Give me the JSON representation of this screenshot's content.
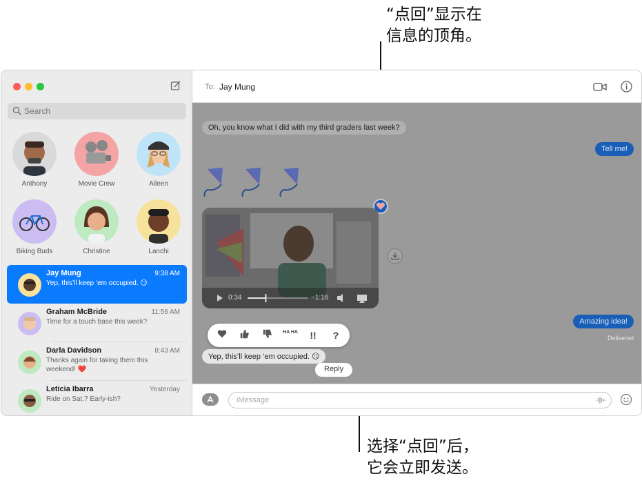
{
  "annotations": {
    "top_line1": "“点回”显示在",
    "top_line2": "信息的顶角。",
    "bottom_line1": "选择“点回”后，",
    "bottom_line2": "它会立即发送。"
  },
  "sidebar": {
    "search_placeholder": "Search",
    "pinned": [
      {
        "name": "Anthony",
        "icon": "memoji-avatar",
        "bg": "#d9d9d9"
      },
      {
        "name": "Movie Crew",
        "icon": "movie-projector-avatar",
        "bg": "#f4a4a4"
      },
      {
        "name": "Aileen",
        "icon": "memoji-avatar",
        "bg": "#bfe3f7"
      },
      {
        "name": "Biking Buds",
        "icon": "bicycle-avatar",
        "bg": "#cbbdf2"
      },
      {
        "name": "Christine",
        "icon": "memoji-avatar",
        "bg": "#bdeac0"
      },
      {
        "name": "Lanchi",
        "icon": "memoji-avatar",
        "bg": "#f7e29c"
      }
    ],
    "conversations": [
      {
        "name": "Jay Mung",
        "time": "9:38 AM",
        "preview": "Yep, this’ll keep ‘em occupied. 😏",
        "selected": true
      },
      {
        "name": "Graham McBride",
        "time": "11:56 AM",
        "preview": "Time for a touch base this week?"
      },
      {
        "name": "Darla Davidson",
        "time": "8:43 AM",
        "preview": "Thanks again for taking them this weekend! ❤️"
      },
      {
        "name": "Leticia Ibarra",
        "time": "Yesterday",
        "preview": "Ride on Sat.? Early-ish?"
      }
    ]
  },
  "header": {
    "to_label": "To:",
    "recipient": "Jay Mung"
  },
  "messages": {
    "incoming_1": "Oh, you know what I did with my third graders last week?",
    "outgoing_1": "Tell me!",
    "outgoing_2": "Amazing idea!",
    "delivered": "Delivered",
    "selected": "Yep, this’ll keep ‘em occupied. 😏",
    "video_elapsed": "0:34",
    "video_remaining": "−1:16",
    "video_progress": 0.3
  },
  "tapbacks": {
    "items": [
      "heart",
      "thumbs-up",
      "thumbs-down",
      "haha",
      "exclamation",
      "question"
    ],
    "haha_label": "HA HA",
    "exclamation_label": "!!",
    "question_label": "?",
    "reply_label": "Reply"
  },
  "input": {
    "placeholder": "iMessage"
  },
  "colors": {
    "accent": "#0a7aff",
    "close": "#ff5f57",
    "minimize": "#febc2e",
    "zoom": "#28c840"
  }
}
